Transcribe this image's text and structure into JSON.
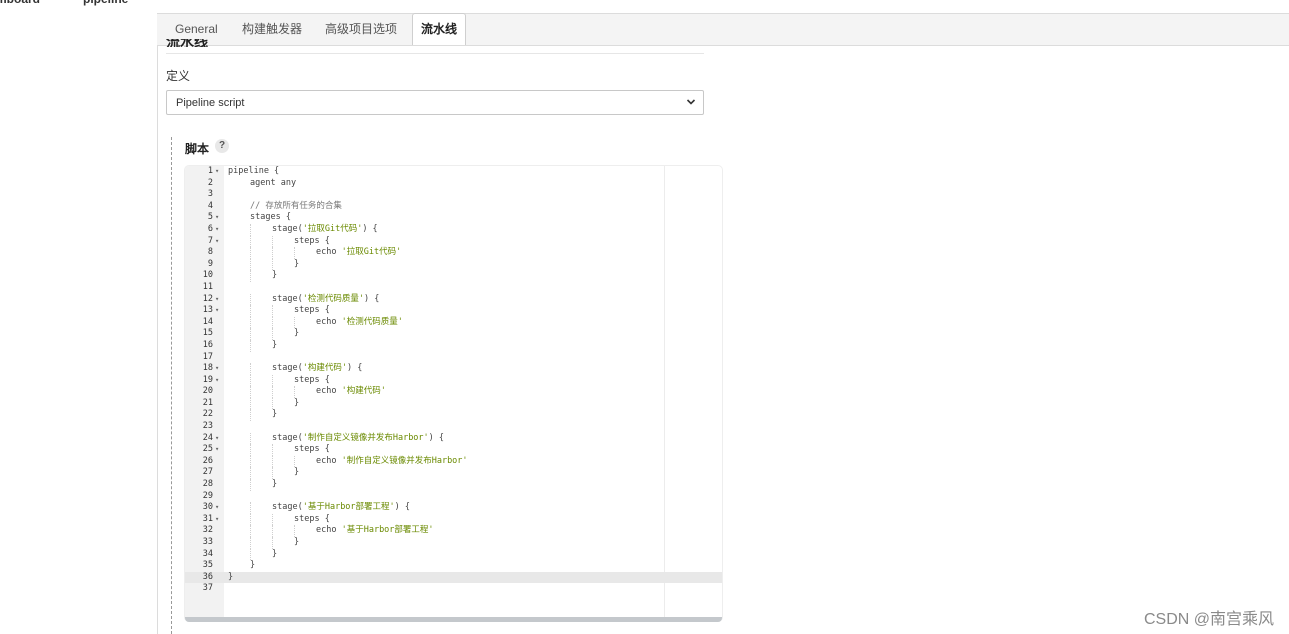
{
  "breadcrumb": {
    "items": [
      "mboard",
      "pipeline"
    ]
  },
  "tabs": [
    {
      "label": "General"
    },
    {
      "label": "构建触发器"
    },
    {
      "label": "高级项目选项"
    },
    {
      "label": "流水线"
    }
  ],
  "section": {
    "title": "流水线"
  },
  "definition": {
    "label": "定义",
    "selected": "Pipeline script"
  },
  "script": {
    "label": "脚本",
    "help": "?",
    "lines": [
      {
        "n": "1",
        "fold": true,
        "indent": 0,
        "parts": [
          {
            "t": "pipeline {"
          }
        ]
      },
      {
        "n": "2",
        "fold": false,
        "indent": 1,
        "parts": [
          {
            "t": "agent any"
          }
        ]
      },
      {
        "n": "3",
        "fold": false,
        "indent": 0,
        "parts": []
      },
      {
        "n": "4",
        "fold": false,
        "indent": 1,
        "parts": [
          {
            "t": "// 存放所有任务的合集",
            "c": "cmt"
          }
        ]
      },
      {
        "n": "5",
        "fold": true,
        "indent": 1,
        "parts": [
          {
            "t": "stages {"
          }
        ]
      },
      {
        "n": "6",
        "fold": true,
        "indent": 2,
        "parts": [
          {
            "t": "stage("
          },
          {
            "t": "'拉取Git代码'",
            "c": "str"
          },
          {
            "t": ") {"
          }
        ]
      },
      {
        "n": "7",
        "fold": true,
        "indent": 3,
        "parts": [
          {
            "t": "steps {"
          }
        ]
      },
      {
        "n": "8",
        "fold": false,
        "indent": 4,
        "parts": [
          {
            "t": "echo "
          },
          {
            "t": "'拉取Git代码'",
            "c": "str"
          }
        ]
      },
      {
        "n": "9",
        "fold": false,
        "indent": 3,
        "parts": [
          {
            "t": "}"
          }
        ]
      },
      {
        "n": "10",
        "fold": false,
        "indent": 2,
        "parts": [
          {
            "t": "}"
          }
        ]
      },
      {
        "n": "11",
        "fold": false,
        "indent": 0,
        "parts": []
      },
      {
        "n": "12",
        "fold": true,
        "indent": 2,
        "parts": [
          {
            "t": "stage("
          },
          {
            "t": "'检测代码质量'",
            "c": "str"
          },
          {
            "t": ") {"
          }
        ]
      },
      {
        "n": "13",
        "fold": true,
        "indent": 3,
        "parts": [
          {
            "t": "steps {"
          }
        ]
      },
      {
        "n": "14",
        "fold": false,
        "indent": 4,
        "parts": [
          {
            "t": "echo "
          },
          {
            "t": "'检测代码质量'",
            "c": "str"
          }
        ]
      },
      {
        "n": "15",
        "fold": false,
        "indent": 3,
        "parts": [
          {
            "t": "}"
          }
        ]
      },
      {
        "n": "16",
        "fold": false,
        "indent": 2,
        "parts": [
          {
            "t": "}"
          }
        ]
      },
      {
        "n": "17",
        "fold": false,
        "indent": 0,
        "parts": []
      },
      {
        "n": "18",
        "fold": true,
        "indent": 2,
        "parts": [
          {
            "t": "stage("
          },
          {
            "t": "'构建代码'",
            "c": "str"
          },
          {
            "t": ") {"
          }
        ]
      },
      {
        "n": "19",
        "fold": true,
        "indent": 3,
        "parts": [
          {
            "t": "steps {"
          }
        ]
      },
      {
        "n": "20",
        "fold": false,
        "indent": 4,
        "parts": [
          {
            "t": "echo "
          },
          {
            "t": "'构建代码'",
            "c": "str"
          }
        ]
      },
      {
        "n": "21",
        "fold": false,
        "indent": 3,
        "parts": [
          {
            "t": "}"
          }
        ]
      },
      {
        "n": "22",
        "fold": false,
        "indent": 2,
        "parts": [
          {
            "t": "}"
          }
        ]
      },
      {
        "n": "23",
        "fold": false,
        "indent": 0,
        "parts": []
      },
      {
        "n": "24",
        "fold": true,
        "indent": 2,
        "parts": [
          {
            "t": "stage("
          },
          {
            "t": "'制作自定义镜像并发布Harbor'",
            "c": "str"
          },
          {
            "t": ") {"
          }
        ]
      },
      {
        "n": "25",
        "fold": true,
        "indent": 3,
        "parts": [
          {
            "t": "steps {"
          }
        ]
      },
      {
        "n": "26",
        "fold": false,
        "indent": 4,
        "parts": [
          {
            "t": "echo "
          },
          {
            "t": "'制作自定义镜像并发布Harbor'",
            "c": "str"
          }
        ]
      },
      {
        "n": "27",
        "fold": false,
        "indent": 3,
        "parts": [
          {
            "t": "}"
          }
        ]
      },
      {
        "n": "28",
        "fold": false,
        "indent": 2,
        "parts": [
          {
            "t": "}"
          }
        ]
      },
      {
        "n": "29",
        "fold": false,
        "indent": 0,
        "parts": []
      },
      {
        "n": "30",
        "fold": true,
        "indent": 2,
        "parts": [
          {
            "t": "stage("
          },
          {
            "t": "'基于Harbor部署工程'",
            "c": "str"
          },
          {
            "t": ") {"
          }
        ]
      },
      {
        "n": "31",
        "fold": true,
        "indent": 3,
        "parts": [
          {
            "t": "steps {"
          }
        ]
      },
      {
        "n": "32",
        "fold": false,
        "indent": 4,
        "parts": [
          {
            "t": "echo "
          },
          {
            "t": "'基于Harbor部署工程'",
            "c": "str"
          }
        ]
      },
      {
        "n": "33",
        "fold": false,
        "indent": 3,
        "parts": [
          {
            "t": "}"
          }
        ]
      },
      {
        "n": "34",
        "fold": false,
        "indent": 2,
        "parts": [
          {
            "t": "}"
          }
        ]
      },
      {
        "n": "35",
        "fold": false,
        "indent": 1,
        "parts": [
          {
            "t": "}"
          }
        ]
      },
      {
        "n": "36",
        "fold": false,
        "indent": 0,
        "active": true,
        "parts": [
          {
            "t": "}"
          }
        ]
      },
      {
        "n": "37",
        "fold": false,
        "indent": 0,
        "parts": []
      }
    ]
  },
  "watermark": "CSDN @南宫乘风",
  "colors": {
    "string": "#6a8a00",
    "comment": "#777777",
    "active_line": "#e8e8e8"
  }
}
